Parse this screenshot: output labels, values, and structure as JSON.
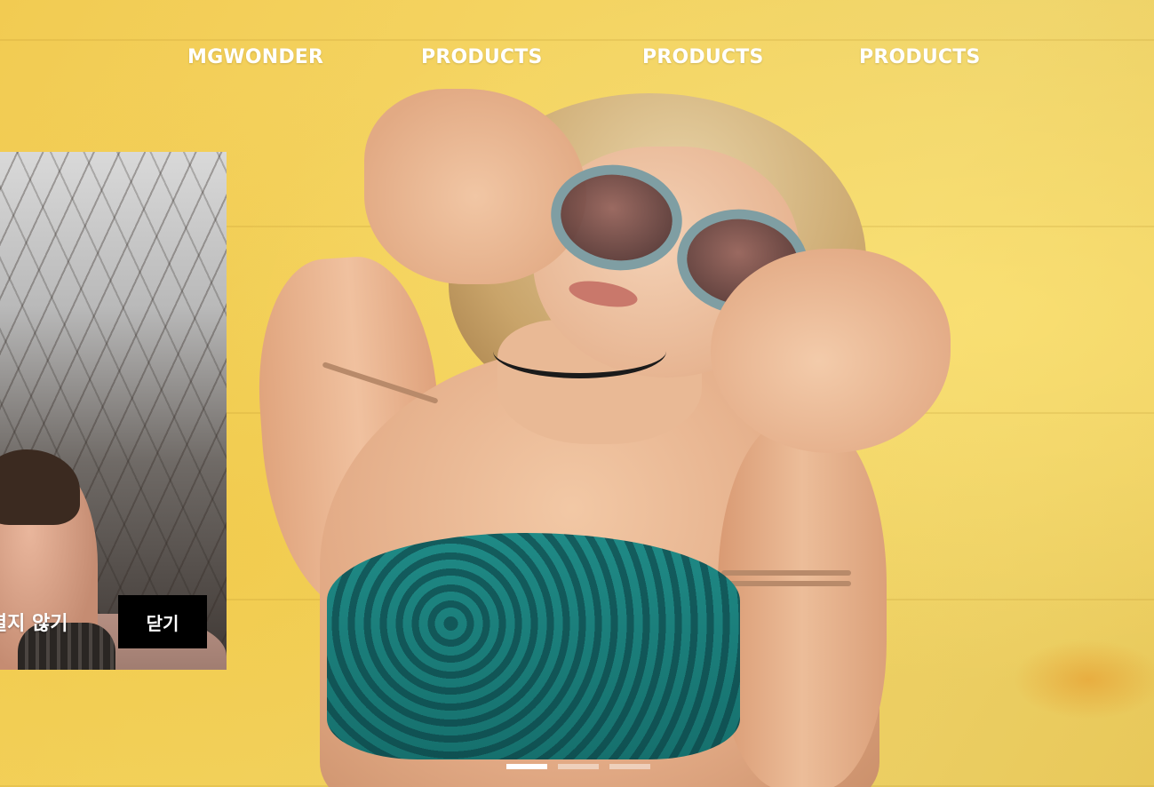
{
  "nav": {
    "items": [
      {
        "label": "MGWONDER"
      },
      {
        "label": "PRODUCTS"
      },
      {
        "label": "PRODUCTS"
      },
      {
        "label": "PRODUCTS"
      }
    ]
  },
  "popup": {
    "dont_show_label": "을 열지 않기",
    "close_label": "닫기"
  },
  "slider": {
    "slide_count": 3,
    "active_index": 0
  },
  "colors": {
    "background": "#f2cb52",
    "nav_text": "#ffffff",
    "close_button_bg": "#000000",
    "indicator_active": "#ffffff"
  }
}
